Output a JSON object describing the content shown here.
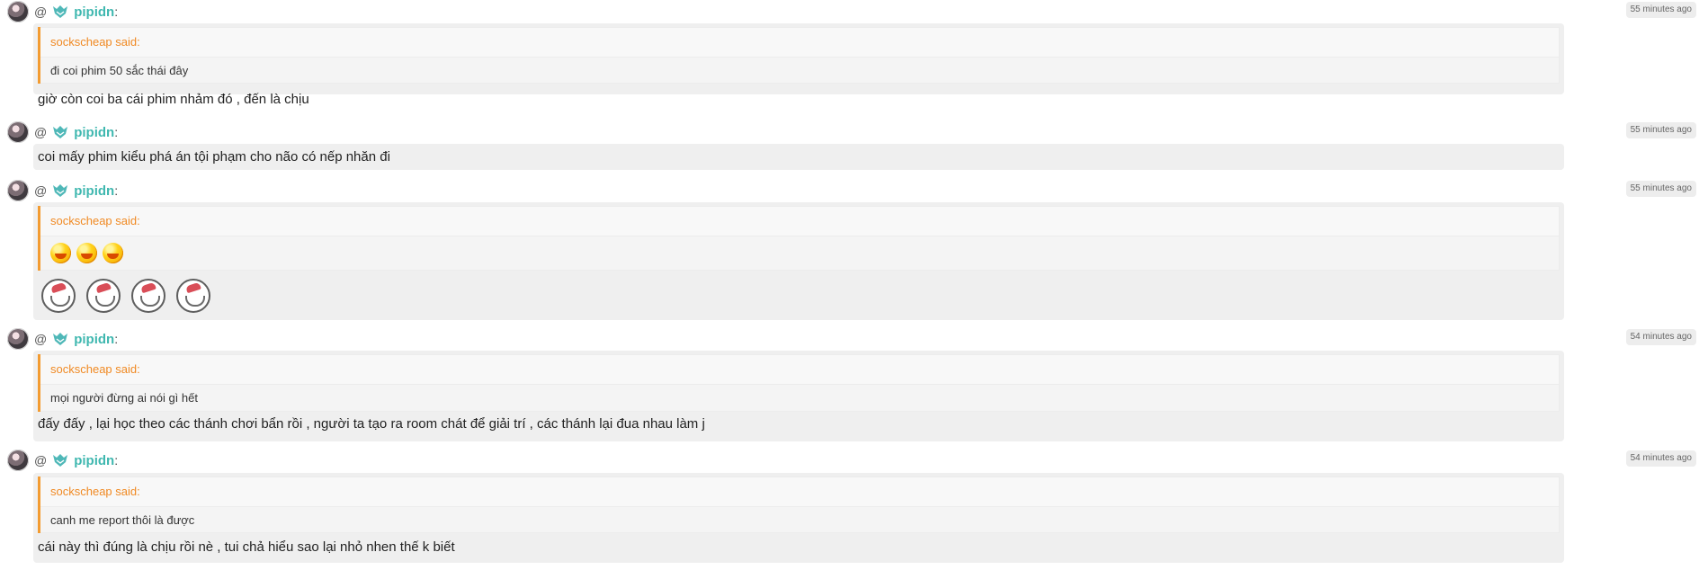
{
  "messages": [
    {
      "at": "@",
      "username": "pipidn",
      "colon": ":",
      "timestamp": "55 minutes ago",
      "quote": {
        "author": "sockscheap said:",
        "text": "đi coi phim 50 sắc thái đây"
      },
      "text": "giờ còn coi ba cái phim nhảm đó , đến là chịu"
    },
    {
      "at": "@",
      "username": "pipidn",
      "colon": ":",
      "timestamp": "55 minutes ago",
      "text": "coi mấy phim kiểu phá án tội phạm cho não có nếp nhăn đi"
    },
    {
      "at": "@",
      "username": "pipidn",
      "colon": ":",
      "timestamp": "55 minutes ago",
      "quote": {
        "author": "sockscheap said:",
        "emoticons": [
          "laughing-emoticon",
          "laughing-emoticon",
          "laughing-emoticon"
        ]
      },
      "stickers": [
        "laughing-sticker",
        "laughing-sticker",
        "laughing-sticker",
        "laughing-sticker"
      ]
    },
    {
      "at": "@",
      "username": "pipidn",
      "colon": ":",
      "timestamp": "54 minutes ago",
      "quote": {
        "author": "sockscheap said:",
        "text": "mọi người đừng ai nói gì hết"
      },
      "text": "đấy đấy , lại học theo các thánh chơi bẩn rồi , người ta tạo ra room chát để giải trí , các thánh lại đua nhau làm j"
    },
    {
      "at": "@",
      "username": "pipidn",
      "colon": ":",
      "timestamp": "54 minutes ago",
      "quote": {
        "author": "sockscheap said:",
        "text": "canh me report thôi là được"
      },
      "text": "cái này thì đúng là chịu rồi nè , tui chả hiểu sao lại nhỏ nhen thế k biết"
    }
  ],
  "colors": {
    "username": "#40b8b0",
    "quote_author": "#f08a24",
    "quote_border": "#f39c32",
    "bubble": "#efefef"
  }
}
